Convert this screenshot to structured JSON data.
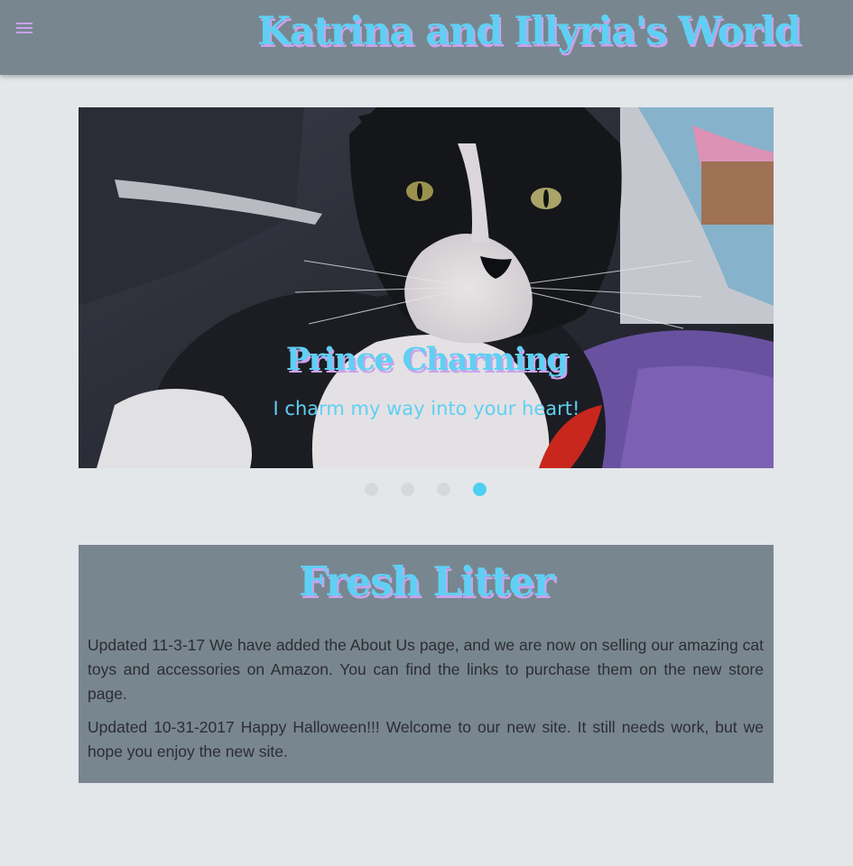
{
  "header": {
    "menu_icon": "hamburger-menu-icon",
    "title": "Katrina and Illyria's World"
  },
  "carousel": {
    "slide_title": "Prince Charming",
    "slide_subtitle": "I charm my way into your heart!",
    "slide_count": 4,
    "active_index": 3
  },
  "news": {
    "heading": "Fresh Litter",
    "paragraphs": [
      "Updated 11-3-17 We have added the About Us page, and we are now on selling our amazing cat toys and accessories on Amazon. You can find the links to purchase them on the new store page.",
      "Updated 10-31-2017 Happy Halloween!!! Welcome to our new site. It still needs work, but we hope you enjoy the new site."
    ]
  },
  "colors": {
    "header_bg": "#78868f",
    "page_bg": "#e3e7ea",
    "accent_blue": "#5fd0f3",
    "accent_purple": "#c9a3ec",
    "dot_active": "#4fcff2",
    "dot_inactive": "#d6d9dc"
  }
}
